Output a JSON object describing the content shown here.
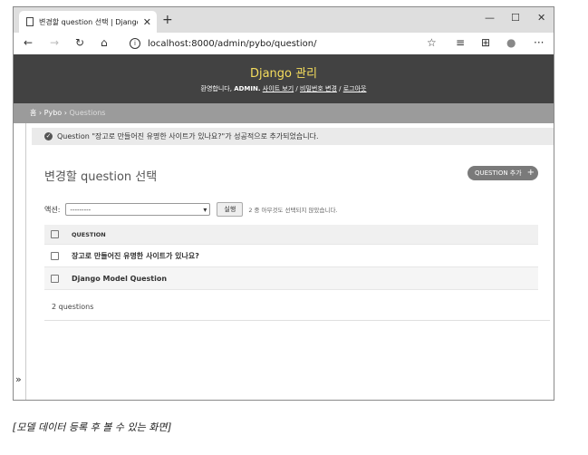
{
  "browser": {
    "tab_title": "변경할 question 선택 | Django 사",
    "tab_close": "✕",
    "new_tab": "+",
    "minimize": "—",
    "maximize": "☐",
    "close": "✕",
    "url": "localhost:8000/admin/pybo/question/",
    "back": "←",
    "forward": "→",
    "refresh": "↻",
    "home": "⌂",
    "info": "i",
    "favorite": "☆",
    "favorites_list": "≡",
    "collections": "⊞",
    "profile": "●",
    "more": "···"
  },
  "header": {
    "brand": "Django 관리",
    "welcome": "환영합니다,",
    "username": "ADMIN.",
    "view_site": "사이트 보기",
    "change_password": "비밀번호 변경",
    "logout": "로그아웃",
    "sep": "/"
  },
  "breadcrumbs": {
    "home": "홈",
    "app": "Pybo",
    "current": "Questions",
    "sep": "›"
  },
  "message": {
    "icon": "✓",
    "text": "Question \"장고로 만들어진 유명한 사이트가 있나요?\"가 성공적으로 추가되었습니다."
  },
  "page": {
    "title": "변경할 question 선택",
    "add_button": "QUESTION 추가",
    "add_plus": "+",
    "sidebar_toggle": "»"
  },
  "actions": {
    "label": "액션:",
    "selected": "---------",
    "caret": "▾",
    "run": "실행",
    "counter": "2 중 아무것도 선택되지 않았습니다."
  },
  "table": {
    "header": "QUESTION",
    "rows": [
      "장고로 만들어진 유명한 사이트가 있나요?",
      "Django Model Question"
    ],
    "count": "2 questions"
  },
  "caption": "[모델 데이터 등록 후 볼 수 있는 화면]"
}
